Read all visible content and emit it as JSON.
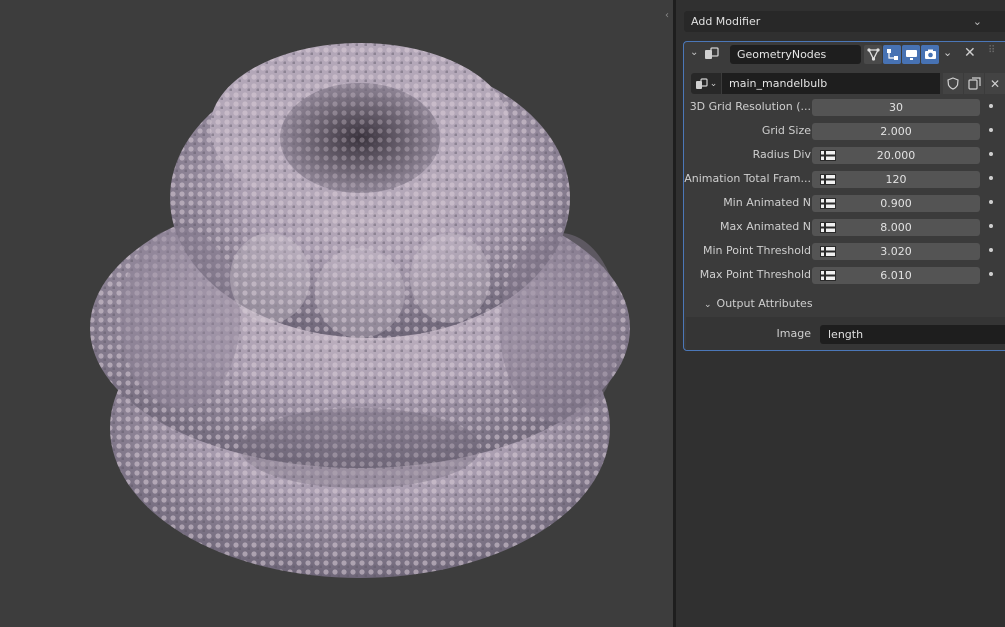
{
  "viewport": {
    "toggle_glyph": "‹"
  },
  "panel": {
    "add_modifier_label": "Add Modifier",
    "modifier": {
      "name": "GeometryNodes",
      "node_tree": "main_mandelbulb",
      "properties": [
        {
          "label": "3D Grid Resolution (...",
          "value": "30",
          "has_attr_toggle": false
        },
        {
          "label": "Grid Size",
          "value": "2.000",
          "has_attr_toggle": false
        },
        {
          "label": "Radius Div",
          "value": "20.000",
          "has_attr_toggle": true
        },
        {
          "label": "Animation Total Fram...",
          "value": "120",
          "has_attr_toggle": true
        },
        {
          "label": "Min Animated N",
          "value": "0.900",
          "has_attr_toggle": true
        },
        {
          "label": "Max Animated N",
          "value": "8.000",
          "has_attr_toggle": true
        },
        {
          "label": "Min Point Threshold",
          "value": "3.020",
          "has_attr_toggle": true
        },
        {
          "label": "Max Point Threshold",
          "value": "6.010",
          "has_attr_toggle": true
        }
      ],
      "output_section": {
        "title": "Output Attributes",
        "label": "Image",
        "value": "length"
      }
    }
  },
  "colors": {
    "accent": "#4772b3",
    "selection_border": "#4b77b8",
    "panel_bg": "#303030",
    "viewport_bg": "#3d3d3d"
  }
}
